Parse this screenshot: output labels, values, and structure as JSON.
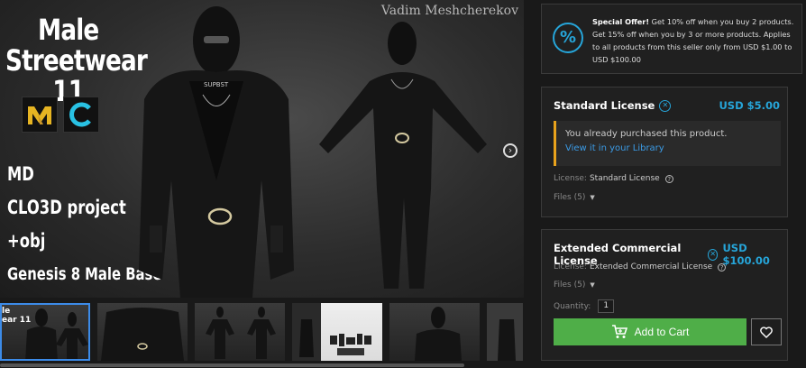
{
  "preview": {
    "watermark": "Vadim Meshcherekov",
    "title_line1": "Male",
    "title_line2": "Streetwear 11",
    "features": [
      "MD",
      "CLO3D project",
      "+obj",
      "Genesis 8 Male Base"
    ],
    "badges": [
      "marvelous-designer-logo",
      "clo3d-logo"
    ],
    "chest_text": "SUPBST"
  },
  "thumbnails": {
    "active_index": 0,
    "first_label_line1": "le",
    "first_label_line2": "ear 11",
    "count": 6
  },
  "offer": {
    "icon": "percent-icon",
    "bold": "Special Offer!",
    "text": " Get 10% off when you buy 2 products. Get 15% off when you by 3 or more products. Applies to all products from this seller only from USD $1.00 to USD $100.00"
  },
  "standard": {
    "title": "Standard License",
    "price": "USD $5.00",
    "owned_text": "You already purchased this product.",
    "owned_link": "View it in your Library",
    "license_label": "License:",
    "license_value": "Standard License",
    "files": "Files (5)"
  },
  "extended": {
    "title": "Extended Commercial License",
    "price": "USD $100.00",
    "license_label": "License:",
    "license_value": "Extended Commercial License",
    "files": "Files (5)",
    "quantity_label": "Quantity:",
    "quantity_value": "1",
    "add_to_cart": "Add to Cart"
  },
  "colors": {
    "accent": "#26a5d9",
    "cart_green": "#4fae48",
    "notice_bar": "#e8a21c",
    "link": "#3b9be6",
    "active_thumb": "#3c8be8"
  }
}
